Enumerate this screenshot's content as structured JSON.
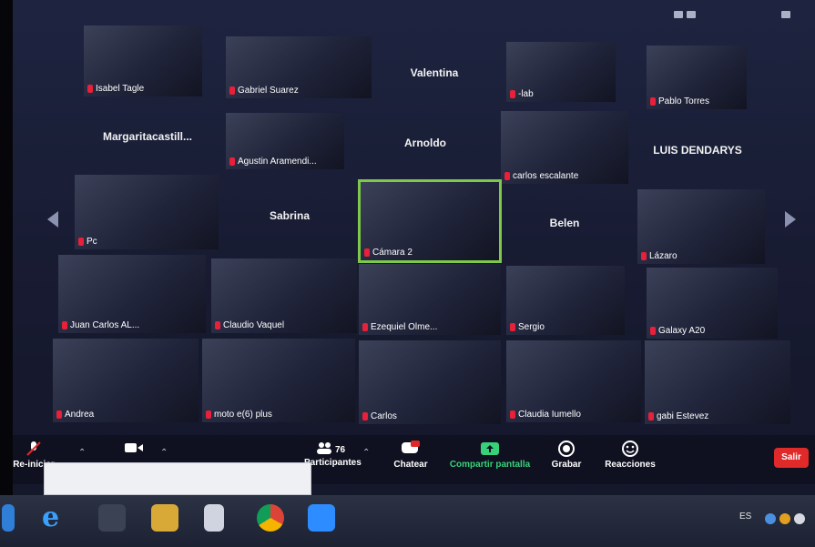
{
  "participants": [
    {
      "name": "Isabel Tagle",
      "type": "video"
    },
    {
      "name": "Gabriel Suarez",
      "type": "video"
    },
    {
      "name": "Valentina",
      "type": "namecard"
    },
    {
      "name": "-lab",
      "type": "video"
    },
    {
      "name": "Pablo Torres",
      "type": "video"
    },
    {
      "name": "Margaritacastill...",
      "type": "namecard"
    },
    {
      "name": "Agustin Aramendi...",
      "type": "video"
    },
    {
      "name": "Arnoldo",
      "type": "namecard"
    },
    {
      "name": "carlos escalante",
      "type": "video"
    },
    {
      "name": "LUIS DENDARYS",
      "type": "namecard"
    },
    {
      "name": "Pc",
      "type": "video"
    },
    {
      "name": "Sabrina",
      "type": "namecard"
    },
    {
      "name": "Cámara 2",
      "type": "video",
      "active": true
    },
    {
      "name": "Belen",
      "type": "namecard"
    },
    {
      "name": "Lázaro",
      "type": "video"
    },
    {
      "name": "Juan Carlos AL...",
      "type": "video"
    },
    {
      "name": "Claudio Vaquel",
      "type": "video"
    },
    {
      "name": "Ezequiel Olme...",
      "type": "video"
    },
    {
      "name": "Sergio",
      "type": "video"
    },
    {
      "name": "Galaxy A20",
      "type": "video"
    },
    {
      "name": "Andrea",
      "type": "video"
    },
    {
      "name": "moto e(6) plus",
      "type": "video"
    },
    {
      "name": "Carlos",
      "type": "video"
    },
    {
      "name": "Claudia Iumello",
      "type": "video"
    },
    {
      "name": "gabi Estevez",
      "type": "video"
    }
  ],
  "controls": {
    "mute_label": "Re-iniciar",
    "participants_count": "76",
    "participants_label": "Participantes",
    "chat_label": "Chatear",
    "share_label": "Compartir pantalla",
    "record_label": "Grabar",
    "reactions_label": "Reacciones",
    "leave_label": "Salir"
  },
  "taskbar": {
    "language": "ES"
  },
  "colors": {
    "accent_green": "#7ec84a",
    "mic_red": "#e8203a",
    "leave_red": "#e02929",
    "share_green": "#38d17a"
  }
}
